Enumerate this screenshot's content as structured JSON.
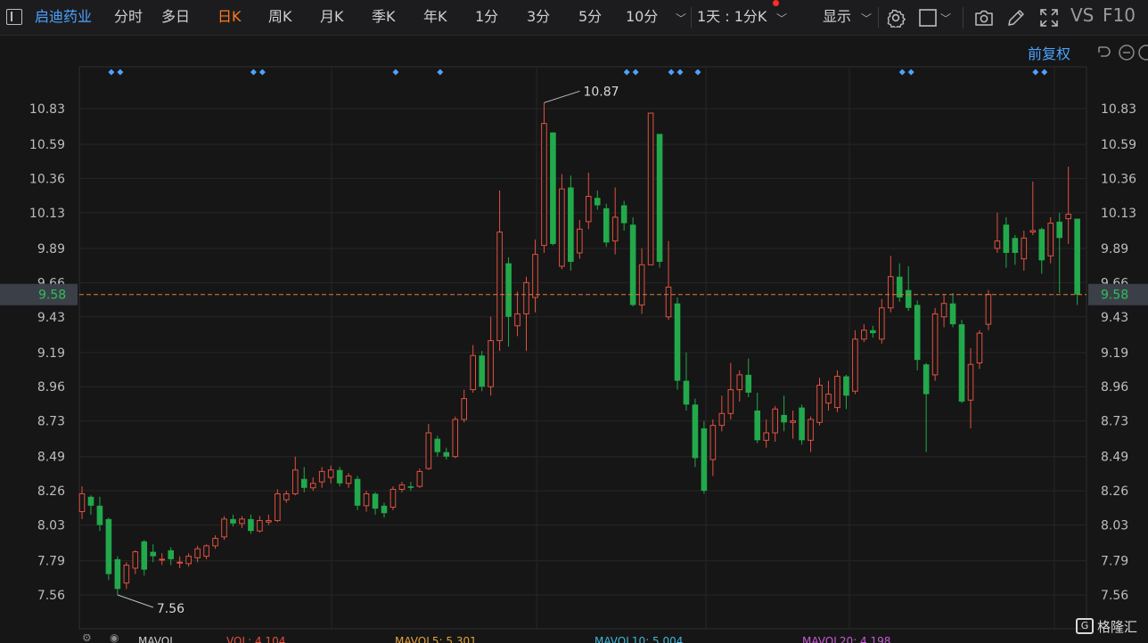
{
  "toolbar": {
    "stock_name": "启迪药业",
    "periods": [
      "分时",
      "多日",
      "日K",
      "周K",
      "月K",
      "季K",
      "年K",
      "1分",
      "3分",
      "5分",
      "10分"
    ],
    "active_period": "日K",
    "range_selector": "1天 : 1分K",
    "display_label": "显示",
    "vs_label": "VS",
    "f10_label": "F10",
    "icons": [
      "sidebar-toggle-icon",
      "settings-icon",
      "color-square-icon",
      "camera-icon",
      "pencil-icon",
      "fullscreen-icon"
    ]
  },
  "sub_toolbar": {
    "adjust_label": "前复权",
    "icons": [
      "undo-icon",
      "zoom-out-icon",
      "more-icon"
    ]
  },
  "watermark": {
    "logo": "G",
    "text": "格隆汇"
  },
  "footer": {
    "mavol": "MAVOL",
    "vol": "VOL: 4.104",
    "mavol5": "MAVOL5: 5.301",
    "mavol10": "MAVOL10: 5.004",
    "mavol20": "MAVOL20: 4.198"
  },
  "colors": {
    "up": "#e2513f",
    "down": "#22a94b",
    "background": "#161616",
    "current_price_line": "#e07b3a",
    "current_price_label_bg": "#3b4048",
    "accent": "#4da3ff"
  },
  "chart_data": {
    "type": "candlestick",
    "y_ticks": [
      10.83,
      10.59,
      10.36,
      10.13,
      9.89,
      9.66,
      9.43,
      9.19,
      8.96,
      8.73,
      8.49,
      8.26,
      8.03,
      7.79,
      7.56
    ],
    "ylim": [
      7.45,
      11.05
    ],
    "current_price": 9.58,
    "max_label": "10.87",
    "min_label": "7.56",
    "candles": [
      [
        8.12,
        8.24,
        8.29,
        8.07
      ],
      [
        8.22,
        8.16,
        8.23,
        8.1
      ],
      [
        8.16,
        8.03,
        8.22,
        7.99
      ],
      [
        8.07,
        7.7,
        8.08,
        7.66
      ],
      [
        7.8,
        7.6,
        7.82,
        7.56
      ],
      [
        7.64,
        7.76,
        7.78,
        7.6
      ],
      [
        7.74,
        7.85,
        7.86,
        7.7
      ],
      [
        7.92,
        7.73,
        7.93,
        7.69
      ],
      [
        7.85,
        7.82,
        7.9,
        7.78
      ],
      [
        7.8,
        7.8,
        7.84,
        7.76
      ],
      [
        7.86,
        7.8,
        7.88,
        7.76
      ],
      [
        7.78,
        7.78,
        7.82,
        7.74
      ],
      [
        7.77,
        7.82,
        7.84,
        7.75
      ],
      [
        7.81,
        7.87,
        7.89,
        7.78
      ],
      [
        7.82,
        7.89,
        7.9,
        7.8
      ],
      [
        7.89,
        7.94,
        7.96,
        7.87
      ],
      [
        7.95,
        8.07,
        8.09,
        7.93
      ],
      [
        8.07,
        8.04,
        8.1,
        8.02
      ],
      [
        8.04,
        8.07,
        8.09,
        8.01
      ],
      [
        8.07,
        7.99,
        8.1,
        7.97
      ],
      [
        7.99,
        8.06,
        8.09,
        7.98
      ],
      [
        8.05,
        8.06,
        8.1,
        8.03
      ],
      [
        8.06,
        8.24,
        8.27,
        8.05
      ],
      [
        8.2,
        8.24,
        8.26,
        8.18
      ],
      [
        8.24,
        8.4,
        8.49,
        8.23
      ],
      [
        8.34,
        8.28,
        8.42,
        8.25
      ],
      [
        8.28,
        8.31,
        8.35,
        8.26
      ],
      [
        8.32,
        8.39,
        8.42,
        8.28
      ],
      [
        8.35,
        8.4,
        8.43,
        8.31
      ],
      [
        8.4,
        8.31,
        8.42,
        8.29
      ],
      [
        8.31,
        8.36,
        8.38,
        8.28
      ],
      [
        8.34,
        8.16,
        8.36,
        8.13
      ],
      [
        8.16,
        8.24,
        8.26,
        8.12
      ],
      [
        8.24,
        8.14,
        8.25,
        8.1
      ],
      [
        8.16,
        8.11,
        8.18,
        8.08
      ],
      [
        8.15,
        8.27,
        8.29,
        8.13
      ],
      [
        8.27,
        8.3,
        8.32,
        8.25
      ],
      [
        8.29,
        8.28,
        8.32,
        8.26
      ],
      [
        8.29,
        8.39,
        8.41,
        8.28
      ],
      [
        8.41,
        8.65,
        8.71,
        8.4
      ],
      [
        8.61,
        8.52,
        8.63,
        8.49
      ],
      [
        8.52,
        8.49,
        8.55,
        8.47
      ],
      [
        8.49,
        8.74,
        8.76,
        8.48
      ],
      [
        8.74,
        8.88,
        8.94,
        8.72
      ],
      [
        8.94,
        9.17,
        9.24,
        8.92
      ],
      [
        9.17,
        8.96,
        9.2,
        8.93
      ],
      [
        8.96,
        9.27,
        9.43,
        8.9
      ],
      [
        9.27,
        10.0,
        10.28,
        9.2
      ],
      [
        9.79,
        9.43,
        9.83,
        9.23
      ],
      [
        9.37,
        9.45,
        9.6,
        9.3
      ],
      [
        9.45,
        9.66,
        9.7,
        9.2
      ],
      [
        9.56,
        9.85,
        9.95,
        9.46
      ],
      [
        9.91,
        10.73,
        10.87,
        9.86
      ],
      [
        10.67,
        9.92,
        10.67,
        9.91
      ],
      [
        9.77,
        10.29,
        10.39,
        9.75
      ],
      [
        10.3,
        9.8,
        10.38,
        9.74
      ],
      [
        9.86,
        10.02,
        10.08,
        9.82
      ],
      [
        10.07,
        10.24,
        10.4,
        10.02
      ],
      [
        10.23,
        10.18,
        10.28,
        10.15
      ],
      [
        10.16,
        9.93,
        10.19,
        9.9
      ],
      [
        9.94,
        10.1,
        10.3,
        9.85
      ],
      [
        10.18,
        10.06,
        10.21,
        10.01
      ],
      [
        10.05,
        9.51,
        10.1,
        9.5
      ],
      [
        9.51,
        9.78,
        9.89,
        9.45
      ],
      [
        9.78,
        10.8,
        10.8,
        9.78
      ],
      [
        10.66,
        9.8,
        10.66,
        9.76
      ],
      [
        9.43,
        9.63,
        9.94,
        9.41
      ],
      [
        9.52,
        9.0,
        9.56,
        8.94
      ],
      [
        9.0,
        8.84,
        9.19,
        8.8
      ],
      [
        8.84,
        8.48,
        8.88,
        8.42
      ],
      [
        8.68,
        8.26,
        8.73,
        8.24
      ],
      [
        8.47,
        8.7,
        8.74,
        8.36
      ],
      [
        8.7,
        8.78,
        8.9,
        8.66
      ],
      [
        8.78,
        8.94,
        9.12,
        8.74
      ],
      [
        8.94,
        9.04,
        9.07,
        8.86
      ],
      [
        9.04,
        8.92,
        9.15,
        8.89
      ],
      [
        8.8,
        8.6,
        8.92,
        8.58
      ],
      [
        8.6,
        8.65,
        8.74,
        8.55
      ],
      [
        8.65,
        8.81,
        8.83,
        8.59
      ],
      [
        8.77,
        8.72,
        8.9,
        8.66
      ],
      [
        8.72,
        8.73,
        8.8,
        8.61
      ],
      [
        8.82,
        8.6,
        8.84,
        8.57
      ],
      [
        8.6,
        8.74,
        8.76,
        8.52
      ],
      [
        8.72,
        8.97,
        9.02,
        8.7
      ],
      [
        8.85,
        8.91,
        9.0,
        8.8
      ],
      [
        8.82,
        9.03,
        9.07,
        8.79
      ],
      [
        9.03,
        8.9,
        9.04,
        8.81
      ],
      [
        8.93,
        9.28,
        9.34,
        8.91
      ],
      [
        9.28,
        9.34,
        9.38,
        9.26
      ],
      [
        9.34,
        9.32,
        9.37,
        9.29
      ],
      [
        9.28,
        9.49,
        9.55,
        9.25
      ],
      [
        9.49,
        9.7,
        9.84,
        9.46
      ],
      [
        9.7,
        9.56,
        9.79,
        9.53
      ],
      [
        9.61,
        9.49,
        9.77,
        9.47
      ],
      [
        9.51,
        9.14,
        9.54,
        9.07
      ],
      [
        9.11,
        8.91,
        9.12,
        8.52
      ],
      [
        9.04,
        9.45,
        9.49,
        9.0
      ],
      [
        9.43,
        9.52,
        9.58,
        9.36
      ],
      [
        9.52,
        9.38,
        9.59,
        9.36
      ],
      [
        9.38,
        8.86,
        9.41,
        8.85
      ],
      [
        8.87,
        9.11,
        9.22,
        8.68
      ],
      [
        9.12,
        9.32,
        9.34,
        9.08
      ],
      [
        9.38,
        9.58,
        9.61,
        9.34
      ],
      [
        9.89,
        9.94,
        10.13,
        9.86
      ],
      [
        10.05,
        9.86,
        10.1,
        9.76
      ],
      [
        9.96,
        9.86,
        9.98,
        9.78
      ],
      [
        9.82,
        9.96,
        10.01,
        9.74
      ],
      [
        10.0,
        10.01,
        10.34,
        9.98
      ],
      [
        10.02,
        9.81,
        10.03,
        9.72
      ],
      [
        9.84,
        10.06,
        10.1,
        9.79
      ],
      [
        10.07,
        9.96,
        10.13,
        9.59
      ],
      [
        10.09,
        10.12,
        10.44,
        9.92
      ],
      [
        10.09,
        9.58,
        10.09,
        9.51
      ]
    ],
    "markers": [
      [
        3,
        4
      ],
      [
        19,
        20
      ],
      [
        35
      ],
      [
        40
      ],
      [
        61,
        62
      ],
      [
        66,
        67
      ],
      [
        69
      ],
      [
        92,
        93
      ],
      [
        107,
        108
      ]
    ]
  }
}
